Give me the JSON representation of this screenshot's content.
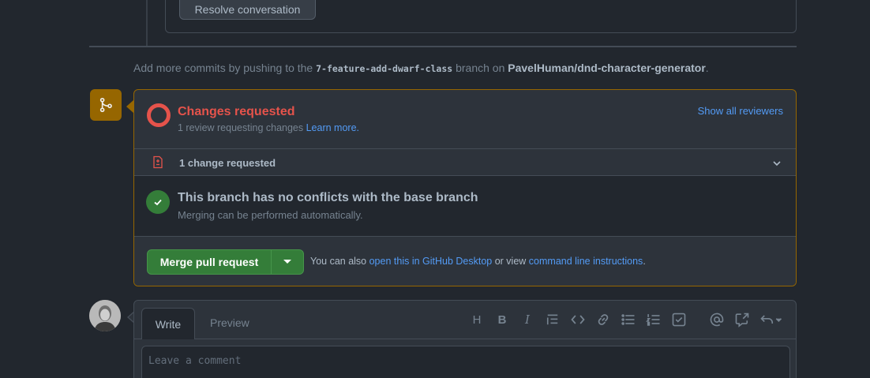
{
  "top": {
    "resolve_label": "Resolve conversation"
  },
  "add_commits": {
    "prefix": "Add more commits by pushing to the ",
    "branch": "7-feature-add-dwarf-class",
    "middle": " branch on ",
    "repo": "PavelHuman/dnd-character-generator",
    "suffix": "."
  },
  "review": {
    "title": "Changes requested",
    "subtitle": "1 review requesting changes ",
    "learn_more": "Learn more.",
    "show_all": "Show all reviewers",
    "change_count_label": "1 change requested"
  },
  "conflicts": {
    "title": "This branch has no conflicts with the base branch",
    "subtitle": "Merging can be performed automatically."
  },
  "merge": {
    "button_label": "Merge pull request",
    "also_prefix": "You can also ",
    "desktop_link": "open this in GitHub Desktop",
    "or_view": " or view ",
    "cli_link": "command line instructions",
    "suffix": "."
  },
  "comment": {
    "tab_write": "Write",
    "tab_preview": "Preview",
    "placeholder": "Leave a comment",
    "toolbar_heading": "H",
    "toolbar_bold": "B",
    "toolbar_italic": "I"
  },
  "colors": {
    "accent_attention": "#966600",
    "danger": "#e5534b",
    "success": "#347d39",
    "link": "#539bf5"
  }
}
